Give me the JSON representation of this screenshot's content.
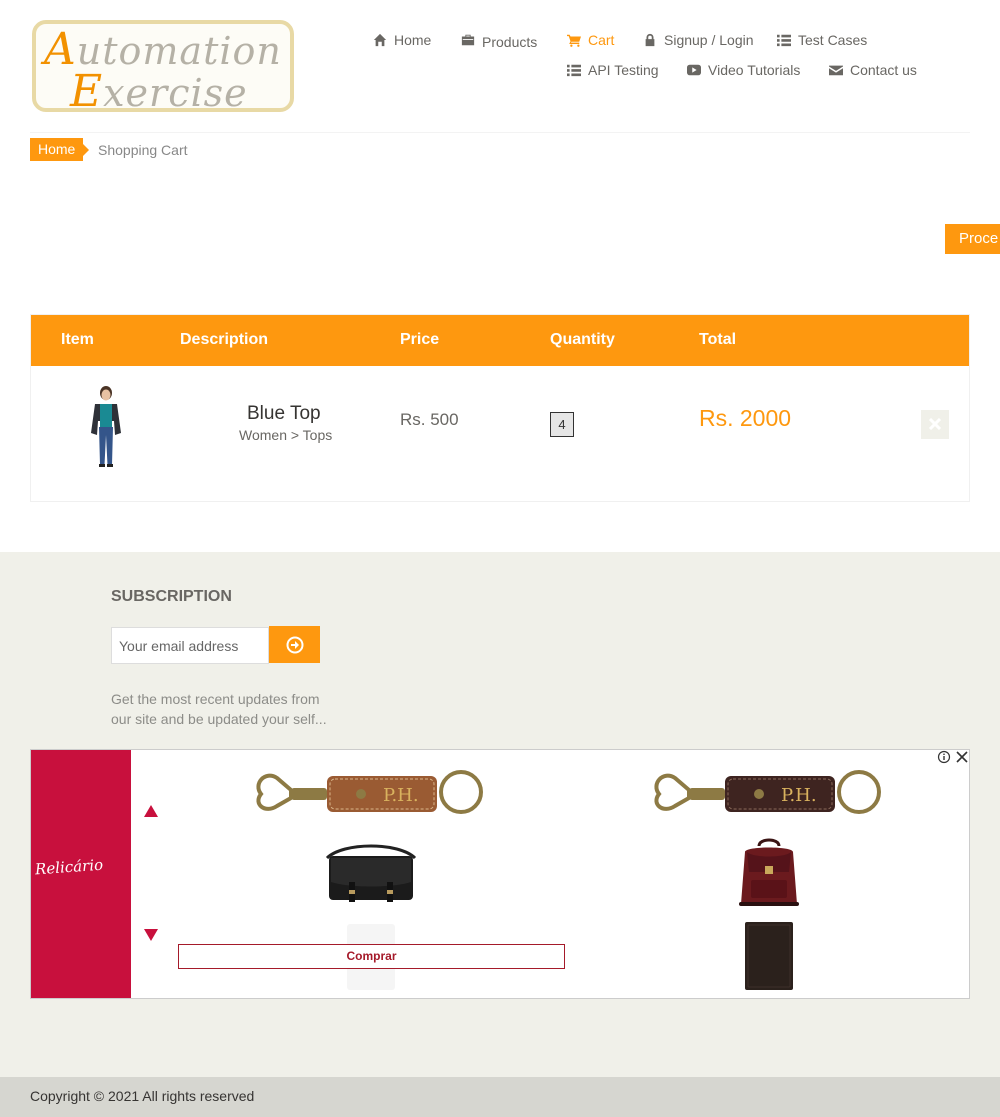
{
  "logo": {
    "line1_cap": "A",
    "line1_rest": "utomation",
    "line2_cap": "E",
    "line2_rest": "xercise"
  },
  "nav": {
    "items": [
      {
        "label": "Home",
        "icon": "home-icon"
      },
      {
        "label": "Products",
        "icon": "briefcase-icon"
      },
      {
        "label": "Cart",
        "icon": "cart-icon",
        "active": true
      },
      {
        "label": "Signup / Login",
        "icon": "lock-icon"
      },
      {
        "label": "Test Cases",
        "icon": "list-icon"
      },
      {
        "label": "API Testing",
        "icon": "list-icon"
      },
      {
        "label": "Video Tutorials",
        "icon": "youtube-play-icon"
      },
      {
        "label": "Contact us",
        "icon": "envelope-icon"
      }
    ]
  },
  "breadcrumb": {
    "home": "Home",
    "current": "Shopping Cart"
  },
  "proceed_label": "Proce",
  "cart": {
    "headers": [
      "Item",
      "Description",
      "Price",
      "Quantity",
      "Total"
    ],
    "rows": [
      {
        "name": "Blue Top",
        "category": "Women > Tops",
        "price": "Rs. 500",
        "quantity": "4",
        "total": "Rs. 2000"
      }
    ]
  },
  "footer": {
    "subscription_title": "SUBSCRIPTION",
    "email_placeholder": "Your email address",
    "subscription_text": "Get the most recent updates from our site and be updated your self...",
    "copyright": "Copyright © 2021 All rights reserved"
  },
  "ad": {
    "brand": "Relicário",
    "cta": "Comprar",
    "monogram": "P.H."
  },
  "colors": {
    "accent": "#fe980f",
    "footer_bg": "#f0f0e9",
    "ad_brand": "#c8103d"
  }
}
